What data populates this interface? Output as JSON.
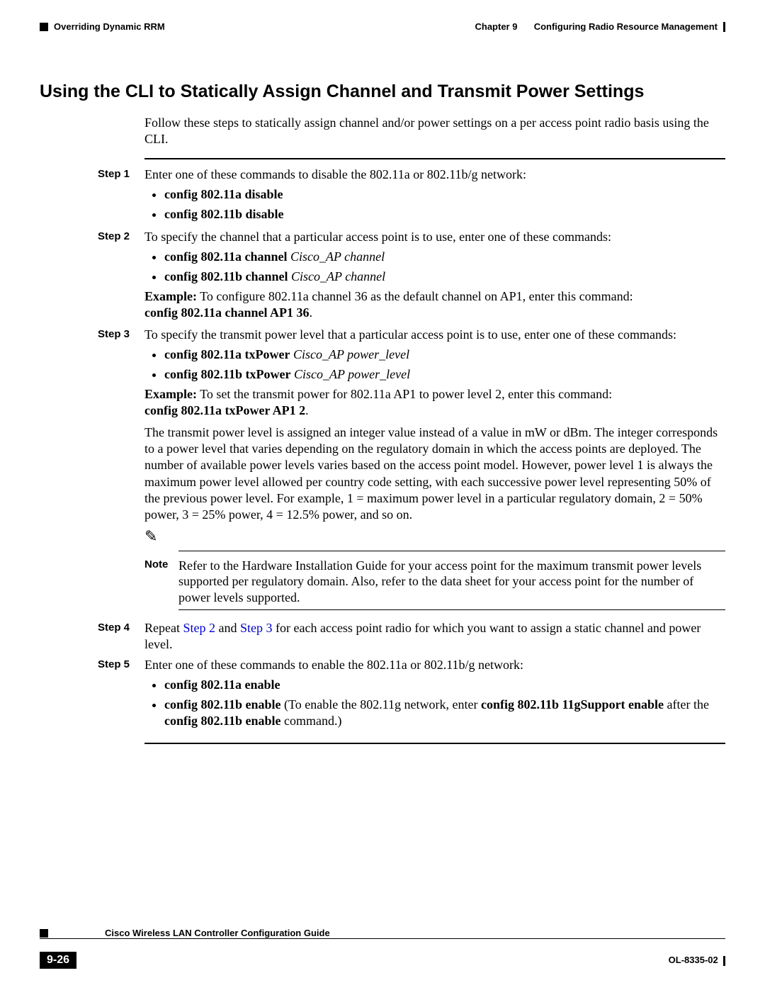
{
  "header": {
    "section_tag": "Overriding Dynamic RRM",
    "chapter_label": "Chapter 9",
    "chapter_title": "Configuring Radio Resource Management"
  },
  "heading": "Using the CLI to Statically Assign Channel and Transmit Power Settings",
  "intro": "Follow these steps to statically assign channel and/or power settings on a per access point radio basis using the CLI.",
  "steps": {
    "s1": {
      "label": "Step 1",
      "text": "Enter one of these commands to disable the 802.11a or 802.11b/g network:",
      "bullets": [
        "config 802.11a disable",
        "config 802.11b disable"
      ]
    },
    "s2": {
      "label": "Step 2",
      "text": "To specify the channel that a particular access point is to use, enter one of these commands:",
      "bullets_bold": [
        "config 802.11a channel",
        "config 802.11b channel"
      ],
      "bullets_ital": [
        "Cisco_AP channel",
        "Cisco_AP channel"
      ],
      "example_lead": "Example:",
      "example_text": " To configure 802.11a channel 36 as the default channel on AP1, enter this command: ",
      "example_cmd": "config 802.11a channel AP1 36"
    },
    "s3": {
      "label": "Step 3",
      "text": "To specify the transmit power level that a particular access point is to use, enter one of these commands:",
      "bullets_bold": [
        "config 802.11a txPower",
        "config 802.11b txPower"
      ],
      "bullets_ital": [
        "Cisco_AP power_level",
        "Cisco_AP power_level"
      ],
      "example_lead": "Example:",
      "example_text": " To set the transmit power for 802.11a AP1 to power level 2, enter this command: ",
      "example_cmd": "config 802.11a txPower AP1 2",
      "para": "The transmit power level is assigned an integer value instead of a value in mW or dBm. The integer corresponds to a power level that varies depending on the regulatory domain in which the access points are deployed. The number of available power levels varies based on the access point model. However, power level 1 is always the maximum power level allowed per country code setting, with each successive power level representing 50% of the previous power level. For example, 1 = maximum power level in a particular regulatory domain, 2 = 50% power, 3 = 25% power, 4 = 12.5% power, and so on.",
      "note_label": "Note",
      "note_text": "Refer to the Hardware Installation Guide for your access point for the maximum transmit power levels supported per regulatory domain. Also, refer to the data sheet for your access point for the number of power levels supported."
    },
    "s4": {
      "label": "Step 4",
      "pre": "Repeat ",
      "link1": "Step 2",
      "mid": " and ",
      "link2": "Step 3",
      "post": " for each access point radio for which you want to assign a static channel and power level."
    },
    "s5": {
      "label": "Step 5",
      "text": "Enter one of these commands to enable the 802.11a or 802.11b/g network:",
      "bullet1": "config 802.11a enable",
      "bullet2_b1": "config 802.11b enable",
      "bullet2_t1": " (To enable the 802.11g network, enter ",
      "bullet2_b2": "config 802.11b 11gSupport enable",
      "bullet2_t2": " after the ",
      "bullet2_b3": "config 802.11b enable",
      "bullet2_t3": " command.)"
    }
  },
  "footer": {
    "guide_title": "Cisco Wireless LAN Controller Configuration Guide",
    "page_num": "9-26",
    "doc_id": "OL-8335-02"
  }
}
